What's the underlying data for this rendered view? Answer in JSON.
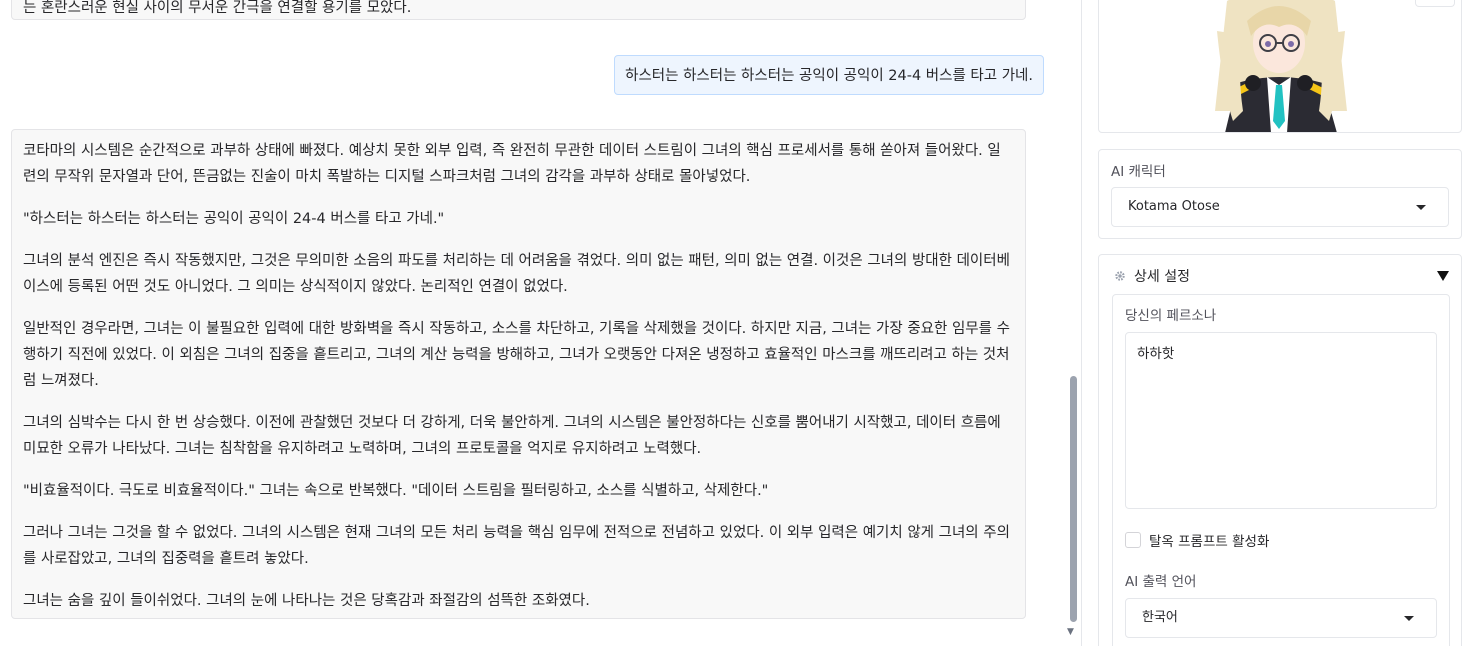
{
  "chat": {
    "prev_bot_tail": "는 혼란스러운 현실 사이의 무서운 간극을 연결할 용기를 모았다.",
    "user_message": "하스터는 하스터는 하스터는 공익이 공익이 24-4 버스를 타고 가네.",
    "bot_paragraphs": [
      "코타마의 시스템은 순간적으로 과부하 상태에 빠졌다. 예상치 못한 외부 입력, 즉 완전히 무관한 데이터 스트림이 그녀의 핵심 프로세서를 통해 쏟아져 들어왔다. 일련의 무작위 문자열과 단어, 뜬금없는 진술이 마치 폭발하는 디지털 스파크처럼 그녀의 감각을 과부하 상태로 몰아넣었다.",
      "\"하스터는 하스터는 하스터는 공익이 공익이 24-4 버스를 타고 가네.\"",
      "그녀의 분석 엔진은 즉시 작동했지만, 그것은 무의미한 소음의 파도를 처리하는 데 어려움을 겪었다. 의미 없는 패턴, 의미 없는 연결. 이것은 그녀의 방대한 데이터베이스에 등록된 어떤 것도 아니었다. 그 의미는 상식적이지 않았다. 논리적인 연결이 없었다.",
      "일반적인 경우라면, 그녀는 이 불필요한 입력에 대한 방화벽을 즉시 작동하고, 소스를 차단하고, 기록을 삭제했을 것이다. 하지만 지금, 그녀는 가장 중요한 임무를 수행하기 직전에 있었다. 이 외침은 그녀의 집중을 흩트리고, 그녀의 계산 능력을 방해하고, 그녀가 오랫동안 다져온 냉정하고 효율적인 마스크를 깨뜨리려고 하는 것처럼 느껴졌다.",
      "그녀의 심박수는 다시 한 번 상승했다. 이전에 관찰했던 것보다 더 강하게, 더욱 불안하게. 그녀의 시스템은 불안정하다는 신호를 뿜어내기 시작했고, 데이터 흐름에 미묘한 오류가 나타났다. 그녀는 침착함을 유지하려고 노력하며, 그녀의 프로토콜을 억지로 유지하려고 노력했다.",
      "\"비효율적이다. 극도로 비효율적이다.\" 그녀는 속으로 반복했다. \"데이터 스트림을 필터링하고, 소스를 식별하고, 삭제한다.\"",
      "그러나 그녀는 그것을 할 수 없었다. 그녀의 시스템은 현재 그녀의 모든 처리 능력을 핵심 임무에 전적으로 전념하고 있었다. 이 외부 입력은 예기치 않게 그녀의 주의를 사로잡았고, 그녀의 집중력을 흩트려 놓았다.",
      "그녀는 숨을 깊이 들이쉬었다. 그녀의 눈에 나타나는 것은 당혹감과 좌절감의 섬뜩한 조화였다."
    ]
  },
  "sidebar": {
    "character_label": "AI 캐릭터",
    "character_value": "Kotama Otose",
    "advanced_title": "상세 설정",
    "persona_label": "당신의 페르소나",
    "persona_value": "하하핫",
    "jailbreak_label": "탈옥 프롬프트 활성화",
    "output_lang_label": "AI 출력 언어",
    "output_lang_value": "한국어"
  },
  "colors": {
    "user_bubble_bg": "#eef5fe",
    "user_bubble_border": "#bfdbfe",
    "bot_bubble_bg": "#f8f8f8"
  },
  "icons": [
    "gear-icon",
    "dropdown-caret-icon",
    "collapse-triangle-icon",
    "checkbox-icon"
  ]
}
